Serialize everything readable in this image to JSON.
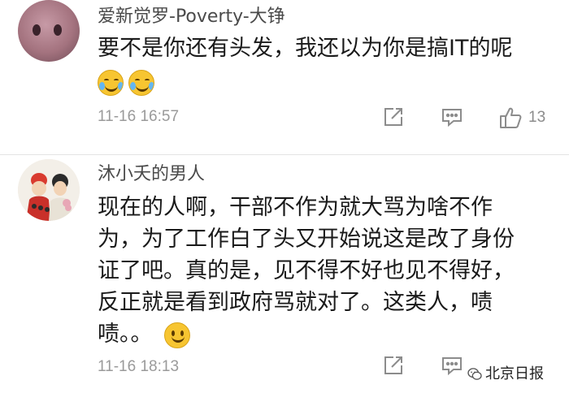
{
  "comments": [
    {
      "username": "爱新觉罗-Poverty-大铮",
      "text_lines": [
        "要不是你还有头发，我还以为你是搞IT的呢"
      ],
      "emojis": [
        "cry-laugh-emoji",
        "cry-laugh-emoji"
      ],
      "timestamp": "11-16 16:57",
      "like_count": "13"
    },
    {
      "username": "沐小夭的男人",
      "text_lines": [
        "现在的人啊，干部不作为就大骂为啥不作",
        "为，为了工作白了头又开始说这是改了身份",
        "证了吧。真的是，见不得不好也见不得好，",
        "反正就是看到政府骂就对了。这类人，啧",
        "啧。。"
      ],
      "emojis": [
        "smile-emoji"
      ],
      "timestamp": "11-16 18:13",
      "like_count": ""
    }
  ],
  "icons": {
    "share": "share-icon",
    "reply": "comment-icon",
    "like": "thumbs-up-icon"
  },
  "watermark": {
    "text": "北京日报",
    "logo": "wechat-logo-icon"
  },
  "colors": {
    "username": "#4a4a4a",
    "meta": "#9a9a9a",
    "emoji": "#f7c531"
  }
}
